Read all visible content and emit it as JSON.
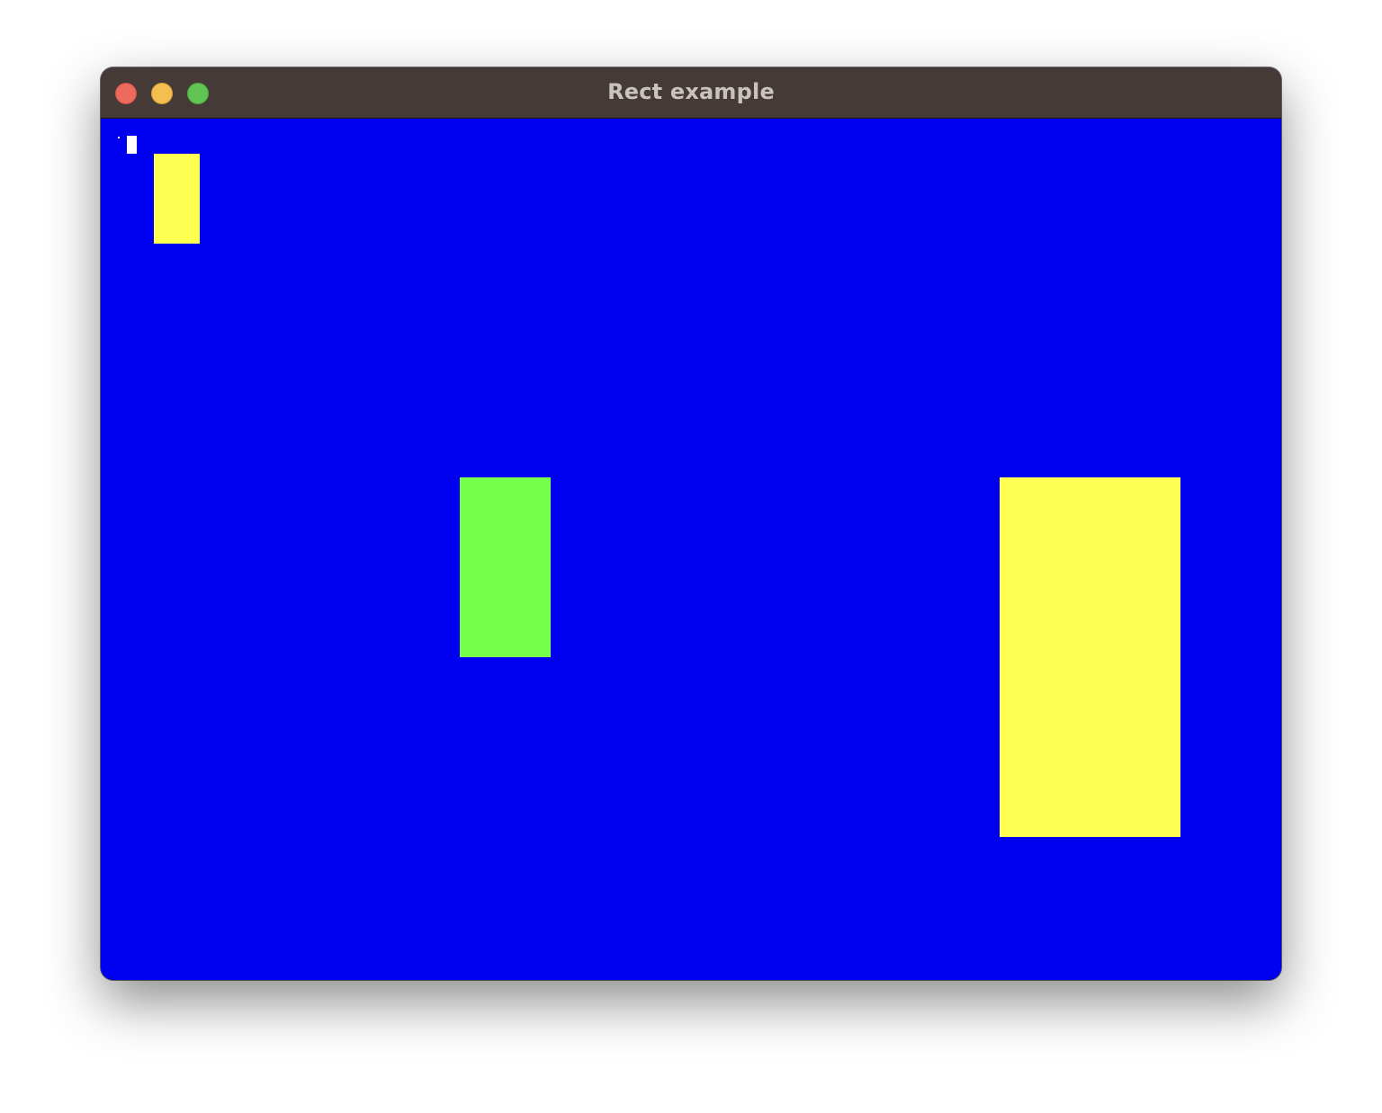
{
  "window": {
    "title": "Rect example",
    "background_color": "#0000f0",
    "titlebar_color": "#453a36"
  },
  "traffic_lights": {
    "close": "close-icon",
    "minimize": "minimize-icon",
    "zoom": "zoom-icon"
  },
  "canvas": {
    "shapes": [
      {
        "name": "tiny-white-dot",
        "color": "#ffffff"
      },
      {
        "name": "small-white-rect",
        "color": "#ffffff"
      },
      {
        "name": "small-yellow-rect",
        "color": "#ffff52"
      },
      {
        "name": "green-rect",
        "color": "#75ff4a"
      },
      {
        "name": "large-yellow-rect",
        "color": "#ffff52"
      }
    ]
  }
}
